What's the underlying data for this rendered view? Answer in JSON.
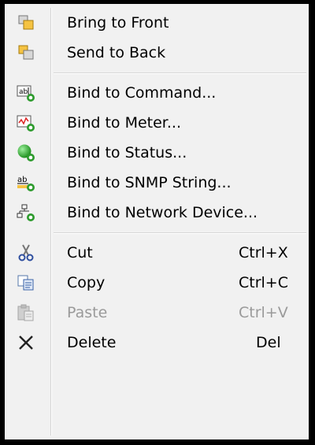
{
  "menu": {
    "items": [
      {
        "label": "Bring to Front",
        "icon": "bring-to-front-icon"
      },
      {
        "label": "Send to Back",
        "icon": "send-to-back-icon"
      },
      {
        "label": "Bind to Command...",
        "icon": "bind-command-icon"
      },
      {
        "label": "Bind to Meter...",
        "icon": "bind-meter-icon"
      },
      {
        "label": "Bind to Status...",
        "icon": "bind-status-icon"
      },
      {
        "label": "Bind to SNMP String...",
        "icon": "bind-snmp-string-icon"
      },
      {
        "label": "Bind to Network Device...",
        "icon": "bind-network-device-icon"
      },
      {
        "label": "Cut",
        "shortcut": "Ctrl+X",
        "icon": "scissors-icon"
      },
      {
        "label": "Copy",
        "shortcut": "Ctrl+C",
        "icon": "copy-icon"
      },
      {
        "label": "Paste",
        "shortcut": "Ctrl+V",
        "icon": "paste-icon",
        "disabled": true
      },
      {
        "label": "Delete",
        "shortcut": "Del",
        "icon": "delete-x-icon"
      }
    ]
  },
  "colors": {
    "menu_background": "#f1f1f1",
    "disabled_text": "#9a9a9a",
    "bind_badge_green": "#2e9b2e",
    "status_ball_green": "#22aa22",
    "cut_blue": "#2f4f9f"
  }
}
